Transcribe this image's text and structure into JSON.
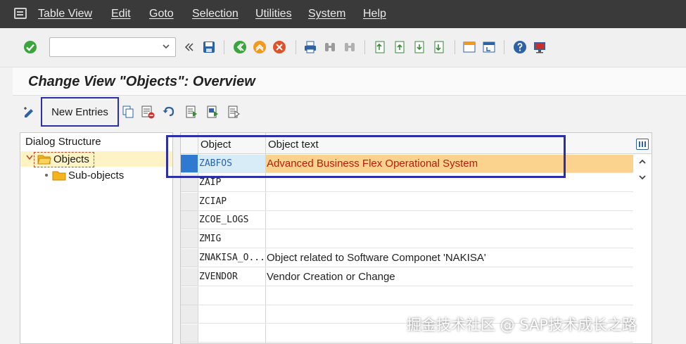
{
  "menu": {
    "items": [
      "Table View",
      "Edit",
      "Goto",
      "Selection",
      "Utilities",
      "System",
      "Help"
    ]
  },
  "toolbar": {
    "command_field_value": "",
    "icons": [
      "enter-check-icon",
      "double-arrow-left-icon",
      "save-icon",
      "back-icon",
      "exit-icon",
      "cancel-icon",
      "print-icon",
      "find-icon",
      "find-next-icon",
      "first-page-icon",
      "previous-page-icon",
      "next-page-icon",
      "last-page-icon",
      "create-session-icon",
      "shortcut-icon",
      "help-icon",
      "customize-layout-icon"
    ]
  },
  "page": {
    "title": "Change View \"Objects\": Overview"
  },
  "app_toolbar": {
    "new_entries_label": "New Entries"
  },
  "dialog_structure": {
    "heading": "Dialog Structure",
    "nodes": [
      {
        "label": "Objects",
        "selected": true
      },
      {
        "label": "Sub-objects",
        "selected": false
      }
    ]
  },
  "table": {
    "columns": [
      "Object",
      "Object text"
    ],
    "rows": [
      {
        "object": "ZABFOS",
        "text": "Advanced Business Flex Operational System",
        "active": true
      },
      {
        "object": "ZAIP",
        "text": ""
      },
      {
        "object": "ZCIAP",
        "text": ""
      },
      {
        "object": "ZCOE_LOGS",
        "text": ""
      },
      {
        "object": "ZMIG",
        "text": ""
      },
      {
        "object": "ZNAKISA_O...",
        "text": "Object related to Software Componet 'NAKISA'"
      },
      {
        "object": "ZVENDOR",
        "text": "Vendor Creation or Change"
      },
      {
        "object": "",
        "text": ""
      },
      {
        "object": "",
        "text": ""
      },
      {
        "object": "",
        "text": ""
      }
    ]
  },
  "watermark": "掘金技术社区 @ SAP技术成长之路",
  "colors": {
    "menubar": "#3a3a3a",
    "highlight_box": "#2b2fa8",
    "active_row_text": "#b71c0c",
    "active_row_bg": "#fbd28e"
  }
}
